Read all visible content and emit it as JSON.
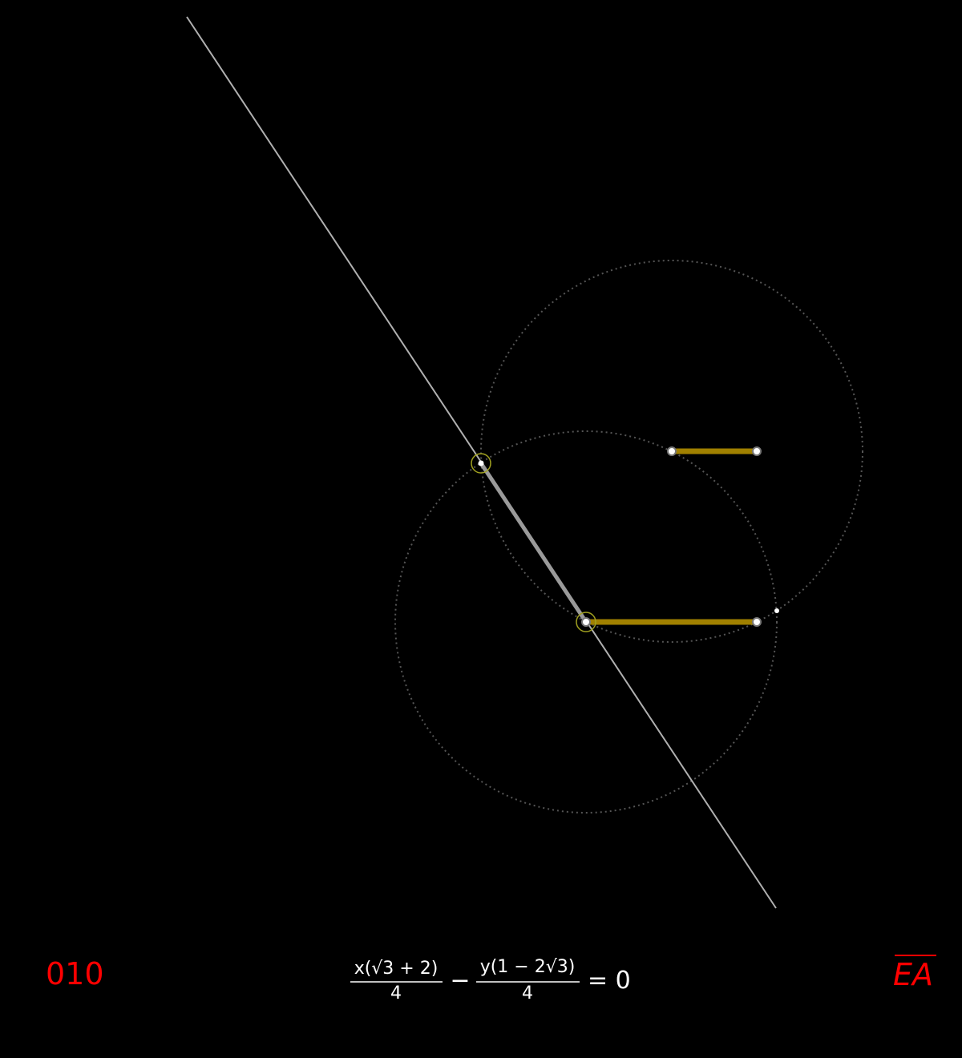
{
  "footer": {
    "step_number": "010",
    "segment_label": "EA",
    "equation": {
      "term1_numerator": "x(√3 + 2)",
      "term1_denominator": "4",
      "operator": "−",
      "term2_numerator": "y(1 − 2√3)",
      "term2_denominator": "4",
      "rhs": "= 0"
    }
  },
  "colors": {
    "background": "#000000",
    "line": "#b0b0b0",
    "segment": "#a08000",
    "circle_dotted": "#555555",
    "highlight_ring": "#a0a020",
    "label_red": "#ff0000",
    "equation": "#ffffff"
  }
}
